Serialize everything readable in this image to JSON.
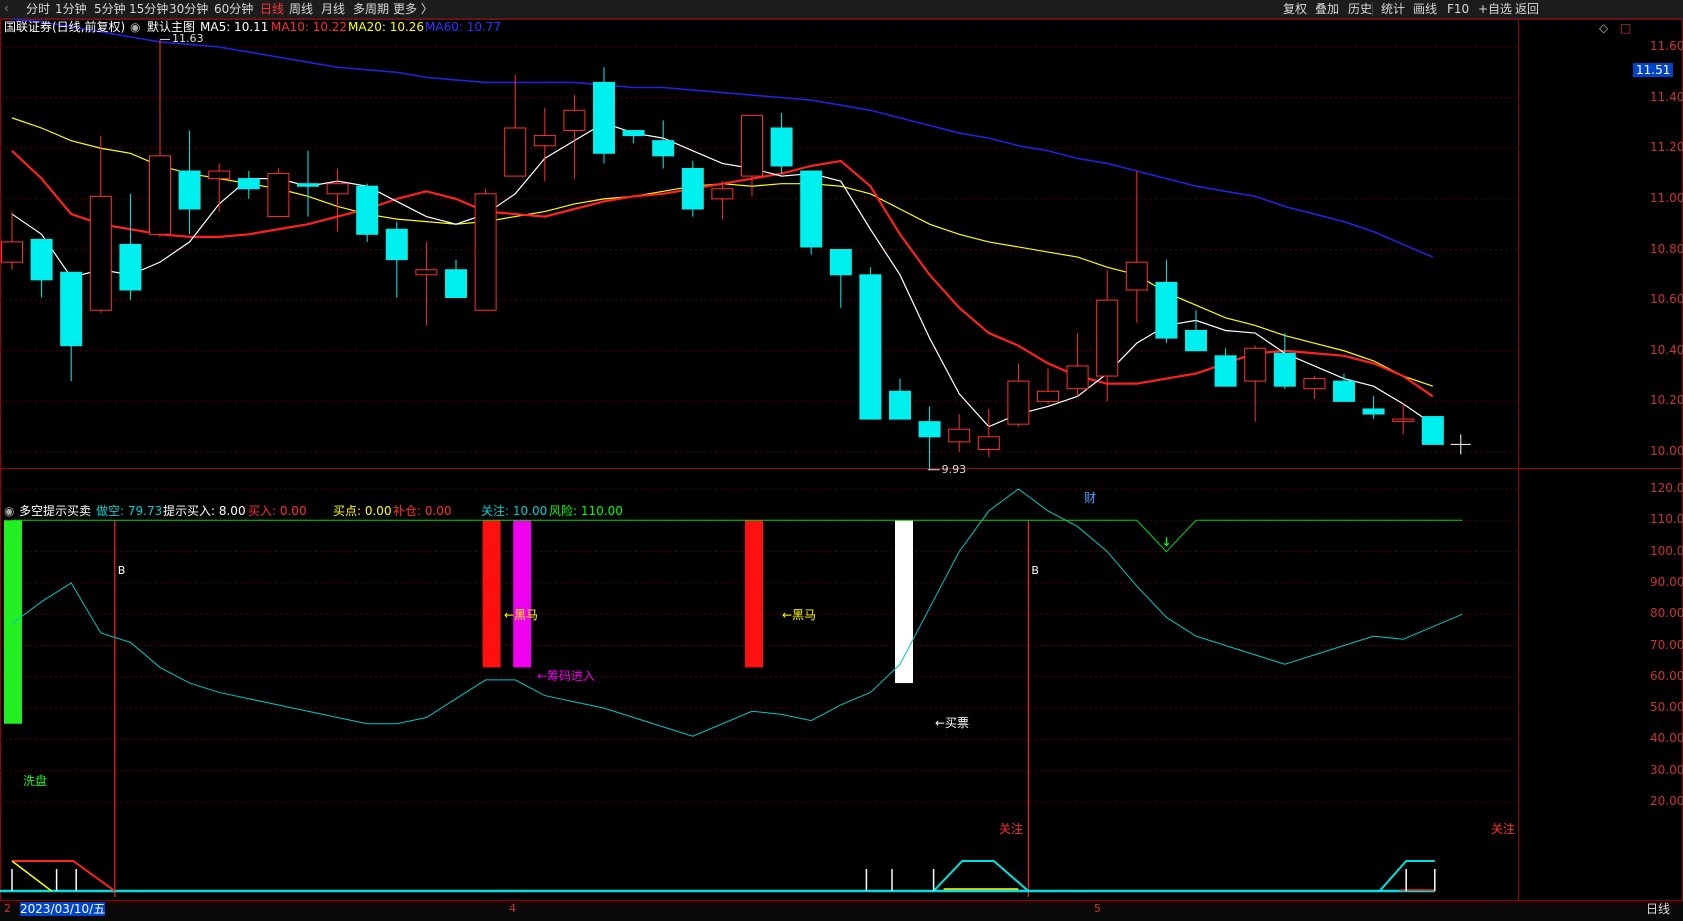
{
  "toolbar": {
    "periods": [
      "分时",
      "1分钟",
      "5分钟",
      "15分钟",
      "30分钟",
      "60分钟",
      "日线",
      "周线",
      "月线",
      "多周期",
      "更多 〉"
    ],
    "active_period": "日线",
    "right_buttons": [
      "复权",
      "叠加",
      "历史",
      "统计",
      "画线",
      "F10",
      "+自选",
      "返回"
    ]
  },
  "main_panel": {
    "title": "国联证券(日线,前复权)",
    "indicator_name": "默认主图",
    "ma5_label": "MA5: 10.11",
    "ma10_label": "MA10: 10.22",
    "ma20_label": "MA20: 10.26",
    "ma60_label": "MA60: 10.77",
    "high_marker": "11.63",
    "low_marker": "9.93",
    "current_price": "11.51",
    "finance_flag": "财",
    "price_ticks": [
      "11.60",
      "11.40",
      "11.20",
      "11.00",
      "10.80",
      "10.60",
      "10.40",
      "10.20",
      "10.00"
    ]
  },
  "sub_panel": {
    "indicator_name": "多空提示买卖",
    "zuokong_label": "做空: 79.73",
    "tishi_label": "提示买入: 8.00",
    "mairu_label": "买入: 0.00",
    "maidian_label": "买点: 0.00",
    "bucang_label": "补仓: 0.00",
    "guanzhu_label": "关注: 10.00",
    "fengxian_label": "风险: 110.00",
    "ticks": [
      "120.00",
      "110.00",
      "100.00",
      "90.00",
      "80.00",
      "70.00",
      "60.00",
      "50.00",
      "40.00",
      "30.00",
      "20.00"
    ],
    "signals": {
      "xipan": "洗盘",
      "heima1": "←黑马",
      "heima2": "←黑马",
      "choumajinru": "←筹码进入",
      "maipiao": "←买票",
      "guanzhu1": "关注",
      "guanzhu2": "关注",
      "b1": "B",
      "b2": "B"
    }
  },
  "x_axis": {
    "date_label": "2023/03/10/五",
    "month_labels": [
      "2",
      "4",
      "5"
    ]
  },
  "bottom_right": "日线",
  "colors": {
    "up": "#ff3030",
    "down": "#00f0f0",
    "ma5": "#ffffff",
    "ma10": "#ff2020",
    "ma20": "#ffff00",
    "ma60": "#2222dd",
    "panel_border": "#a00000",
    "grid": "#5a0000"
  },
  "chart_data": [
    {
      "type": "candlestick",
      "title": "国联证券(日线,前复权)",
      "ylim": [
        9.93,
        11.63
      ],
      "candles": [
        {
          "o": 10.75,
          "h": 10.95,
          "l": 10.72,
          "c": 10.83
        },
        {
          "o": 10.84,
          "h": 10.84,
          "l": 10.61,
          "c": 10.68
        },
        {
          "o": 10.71,
          "h": 10.71,
          "l": 10.28,
          "c": 10.42
        },
        {
          "o": 10.56,
          "h": 11.25,
          "l": 10.55,
          "c": 11.01
        },
        {
          "o": 10.82,
          "h": 11.02,
          "l": 10.6,
          "c": 10.64
        },
        {
          "o": 10.86,
          "h": 11.63,
          "l": 10.85,
          "c": 11.17
        },
        {
          "o": 11.11,
          "h": 11.27,
          "l": 10.86,
          "c": 10.96
        },
        {
          "o": 11.08,
          "h": 11.14,
          "l": 10.95,
          "c": 11.11
        },
        {
          "o": 11.08,
          "h": 11.11,
          "l": 11.0,
          "c": 11.04
        },
        {
          "o": 10.93,
          "h": 11.12,
          "l": 10.93,
          "c": 11.1
        },
        {
          "o": 11.06,
          "h": 11.19,
          "l": 10.93,
          "c": 11.05
        },
        {
          "o": 11.02,
          "h": 11.12,
          "l": 10.87,
          "c": 11.06
        },
        {
          "o": 11.05,
          "h": 11.06,
          "l": 10.83,
          "c": 10.86
        },
        {
          "o": 10.88,
          "h": 10.91,
          "l": 10.61,
          "c": 10.76
        },
        {
          "o": 10.7,
          "h": 10.83,
          "l": 10.5,
          "c": 10.72
        },
        {
          "o": 10.72,
          "h": 10.76,
          "l": 10.61,
          "c": 10.61
        },
        {
          "o": 10.56,
          "h": 11.04,
          "l": 10.56,
          "c": 11.02
        },
        {
          "o": 11.09,
          "h": 11.49,
          "l": 11.09,
          "c": 11.28
        },
        {
          "o": 11.21,
          "h": 11.36,
          "l": 11.07,
          "c": 11.25
        },
        {
          "o": 11.27,
          "h": 11.41,
          "l": 11.08,
          "c": 11.35
        },
        {
          "o": 11.46,
          "h": 11.52,
          "l": 11.14,
          "c": 11.18
        },
        {
          "o": 11.27,
          "h": 11.27,
          "l": 11.22,
          "c": 11.25
        },
        {
          "o": 11.23,
          "h": 11.31,
          "l": 11.12,
          "c": 11.17
        },
        {
          "o": 11.12,
          "h": 11.15,
          "l": 10.93,
          "c": 10.96
        },
        {
          "o": 11.0,
          "h": 11.07,
          "l": 10.92,
          "c": 11.04
        },
        {
          "o": 11.09,
          "h": 11.3,
          "l": 11.01,
          "c": 11.33
        },
        {
          "o": 11.28,
          "h": 11.34,
          "l": 11.1,
          "c": 11.13
        },
        {
          "o": 11.11,
          "h": 11.11,
          "l": 10.78,
          "c": 10.81
        },
        {
          "o": 10.8,
          "h": 10.8,
          "l": 10.57,
          "c": 10.7
        },
        {
          "o": 10.7,
          "h": 10.73,
          "l": 10.13,
          "c": 10.13
        },
        {
          "o": 10.24,
          "h": 10.29,
          "l": 10.13,
          "c": 10.13
        },
        {
          "o": 10.12,
          "h": 10.18,
          "l": 9.93,
          "c": 10.06
        },
        {
          "o": 10.04,
          "h": 10.15,
          "l": 10.0,
          "c": 10.09
        },
        {
          "o": 10.01,
          "h": 10.17,
          "l": 9.98,
          "c": 10.06
        },
        {
          "o": 10.11,
          "h": 10.35,
          "l": 10.1,
          "c": 10.28
        },
        {
          "o": 10.2,
          "h": 10.33,
          "l": 10.19,
          "c": 10.24
        },
        {
          "o": 10.25,
          "h": 10.47,
          "l": 10.22,
          "c": 10.34
        },
        {
          "o": 10.3,
          "h": 10.72,
          "l": 10.2,
          "c": 10.6
        },
        {
          "o": 10.64,
          "h": 11.11,
          "l": 10.51,
          "c": 10.75
        },
        {
          "o": 10.67,
          "h": 10.76,
          "l": 10.43,
          "c": 10.45
        },
        {
          "o": 10.48,
          "h": 10.56,
          "l": 10.4,
          "c": 10.4
        },
        {
          "o": 10.38,
          "h": 10.41,
          "l": 10.26,
          "c": 10.26
        },
        {
          "o": 10.28,
          "h": 10.42,
          "l": 10.12,
          "c": 10.41
        },
        {
          "o": 10.39,
          "h": 10.47,
          "l": 10.25,
          "c": 10.26
        },
        {
          "o": 10.25,
          "h": 10.3,
          "l": 10.21,
          "c": 10.29
        },
        {
          "o": 10.28,
          "h": 10.31,
          "l": 10.2,
          "c": 10.2
        },
        {
          "o": 10.17,
          "h": 10.22,
          "l": 10.13,
          "c": 10.15
        },
        {
          "o": 10.12,
          "h": 10.19,
          "l": 10.07,
          "c": 10.13
        },
        {
          "o": 10.14,
          "h": 10.14,
          "l": 10.03,
          "c": 10.03
        }
      ],
      "ma5": [
        10.94,
        10.86,
        10.69,
        10.72,
        10.7,
        10.75,
        10.83,
        10.98,
        11.08,
        11.08,
        11.05,
        11.07,
        11.05,
        10.99,
        10.93,
        10.9,
        10.94,
        11.02,
        11.16,
        11.23,
        11.3,
        11.26,
        11.24,
        11.19,
        11.14,
        11.12,
        11.09,
        11.1,
        11.07,
        10.88,
        10.7,
        10.45,
        10.23,
        10.1,
        10.15,
        10.18,
        10.22,
        10.31,
        10.43,
        10.5,
        10.52,
        10.48,
        10.47,
        10.39,
        10.34,
        10.29,
        10.26,
        10.19,
        10.11
      ],
      "ma10": [
        11.19,
        11.08,
        10.94,
        10.9,
        10.88,
        10.86,
        10.85,
        10.85,
        10.86,
        10.88,
        10.9,
        10.93,
        10.96,
        11.0,
        11.03,
        11.0,
        10.95,
        10.94,
        10.93,
        10.96,
        10.99,
        11.01,
        11.02,
        11.04,
        11.06,
        11.08,
        11.1,
        11.13,
        11.15,
        11.05,
        10.86,
        10.7,
        10.57,
        10.47,
        10.42,
        10.35,
        10.3,
        10.27,
        10.27,
        10.29,
        10.31,
        10.35,
        10.39,
        10.4,
        10.39,
        10.38,
        10.35,
        10.3,
        10.22
      ],
      "ma20": [
        11.32,
        11.28,
        11.23,
        11.2,
        11.18,
        11.13,
        11.1,
        11.08,
        11.06,
        11.04,
        11.01,
        10.97,
        10.94,
        10.92,
        10.91,
        10.9,
        10.91,
        10.93,
        10.95,
        10.98,
        11.0,
        11.01,
        11.03,
        11.05,
        11.06,
        11.05,
        11.06,
        11.06,
        11.05,
        11.02,
        10.96,
        10.9,
        10.86,
        10.83,
        10.81,
        10.79,
        10.77,
        10.73,
        10.7,
        10.63,
        10.58,
        10.53,
        10.5,
        10.46,
        10.43,
        10.4,
        10.36,
        10.3,
        10.26
      ],
      "ma60": [
        11.71,
        11.7,
        11.68,
        11.66,
        11.64,
        11.62,
        11.61,
        11.6,
        11.58,
        11.56,
        11.54,
        11.52,
        11.51,
        11.5,
        11.48,
        11.47,
        11.46,
        11.46,
        11.46,
        11.46,
        11.45,
        11.44,
        11.44,
        11.43,
        11.42,
        11.41,
        11.4,
        11.39,
        11.37,
        11.35,
        11.32,
        11.29,
        11.26,
        11.24,
        11.21,
        11.19,
        11.16,
        11.14,
        11.11,
        11.08,
        11.05,
        11.03,
        11.01,
        10.97,
        10.94,
        10.91,
        10.87,
        10.82,
        10.77
      ]
    },
    {
      "type": "line",
      "title": "多空提示买卖",
      "ylim": [
        10,
        120
      ],
      "series": [
        {
          "name": "做空",
          "values": [
            77,
            84,
            90,
            74,
            71,
            63,
            58,
            55,
            53,
            51,
            49,
            47,
            45,
            45,
            47,
            53,
            59,
            59,
            54,
            52,
            50,
            47,
            44,
            41,
            45,
            49,
            48,
            46,
            51,
            55,
            64,
            82,
            100,
            113,
            120,
            113,
            108,
            100,
            89,
            79,
            73,
            70,
            67,
            64,
            67,
            70,
            73,
            72,
            76,
            80
          ]
        },
        {
          "name": "风险",
          "values": [
            110,
            110,
            110,
            110,
            110,
            110,
            110,
            110,
            110,
            110,
            110,
            110,
            110,
            110,
            110,
            110,
            110,
            110,
            110,
            110,
            110,
            110,
            110,
            110,
            110,
            110,
            110,
            110,
            110,
            110,
            110,
            110,
            110,
            110,
            110,
            110,
            110,
            110,
            110,
            100,
            110,
            110,
            110,
            110,
            110,
            110,
            110,
            110,
            110,
            110
          ]
        }
      ]
    }
  ]
}
